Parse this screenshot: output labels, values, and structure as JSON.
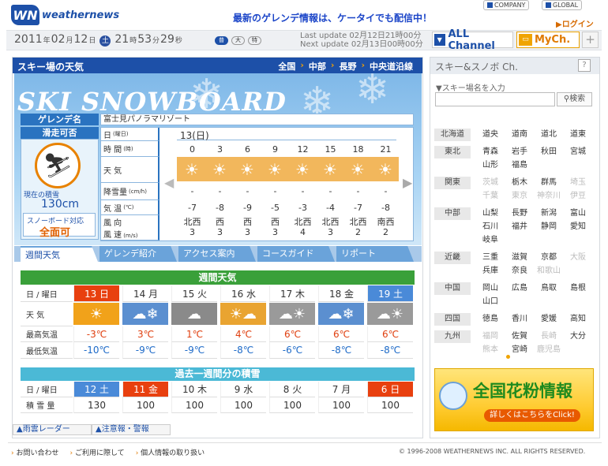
{
  "header": {
    "logo_mark": "WN",
    "logo_text": "weathernews",
    "promo": "最新のゲレンデ情報は、ケータイでも配信中！",
    "company": "COMPANY",
    "global": "GLOBAL",
    "login": "ログイン"
  },
  "topbar": {
    "year": "2011",
    "y_unit": "年",
    "month": "02",
    "m_unit": "月",
    "day": "12",
    "d_unit": "日",
    "dow": "土",
    "hour": "21",
    "h_unit": "時",
    "min": "53",
    "mi_unit": "分",
    "sec": "29",
    "s_unit": "秒",
    "font_sizes": [
      "普",
      "大",
      "特"
    ],
    "last_update": "Last update 02月12日21時00分",
    "next_update": "Next update 02月13日00時00分",
    "all_channel": "ALL Channel",
    "mych": "MyCh.",
    "plus": "+"
  },
  "main": {
    "title": "スキー場の天気",
    "breadcrumb": [
      "全国",
      "中部",
      "長野",
      "中央道沿線"
    ],
    "logo": "SKI SNOWBOARD",
    "ski_label": "ゲレンデ名",
    "ski_name": "富士見パノラマリゾート",
    "open_label": "滑走可否",
    "depth_label": "現在の積雪",
    "depth_value": "130cm",
    "sb_label": "スノーボード対応",
    "sb_value": "全面可",
    "row_labels": {
      "date": "日",
      "date_sub": "(曜日)",
      "time": "時 間",
      "time_sub": "(時)",
      "weather": "天 気",
      "precip": "降雪量",
      "precip_sub": "(cm/h)",
      "temp": "気 温",
      "temp_sub": "(℃)",
      "wind_dir": "風 向",
      "wind_speed": "風 速",
      "wind_sub": "(m/s)"
    },
    "day": "13(日)",
    "hours": [
      "0",
      "3",
      "6",
      "9",
      "12",
      "15",
      "18",
      "21"
    ],
    "precip": [
      "-",
      "-",
      "-",
      "-",
      "-",
      "-",
      "-",
      "-"
    ],
    "temps": [
      "-7",
      "-8",
      "-9",
      "-5",
      "-3",
      "-4",
      "-7",
      "-8"
    ],
    "wind_dirs": [
      "北西",
      "西",
      "西",
      "西",
      "北西",
      "北西",
      "北西",
      "南西"
    ],
    "wind_speeds": [
      "3",
      "3",
      "3",
      "3",
      "4",
      "3",
      "2",
      "2"
    ],
    "tabs": [
      "週間天気",
      "ゲレンデ紹介",
      "アクセス案内",
      "コースガイド",
      "リポート"
    ]
  },
  "weekly": {
    "title": "週間天気",
    "labels": [
      "日 / 曜日",
      "天 気",
      "最高気温",
      "最低気温"
    ],
    "days": [
      {
        "d": "13 日",
        "type": "sun",
        "hi": "-3℃",
        "lo": "-10℃"
      },
      {
        "d": "14 月",
        "type": "cloud-snow",
        "hi": "3℃",
        "lo": "-9℃"
      },
      {
        "d": "15 火",
        "type": "cloud",
        "hi": "1℃",
        "lo": "-9℃"
      },
      {
        "d": "16 水",
        "type": "sun-cloud",
        "hi": "4℃",
        "lo": "-8℃"
      },
      {
        "d": "17 木",
        "type": "cloud-sun",
        "hi": "6℃",
        "lo": "-6℃"
      },
      {
        "d": "18 金",
        "type": "cloud-snow",
        "hi": "6℃",
        "lo": "-8℃"
      },
      {
        "d": "19 土",
        "type": "cloud-sun",
        "hi": "6℃",
        "lo": "-8℃"
      }
    ]
  },
  "past": {
    "title": "過去一週間分の積雪",
    "labels": [
      "日 / 曜日",
      "積 雪 量"
    ],
    "days": [
      "12 土",
      "11 金",
      "10 木",
      "9 水",
      "8 火",
      "7 月",
      "6 日"
    ],
    "values": [
      "130",
      "100",
      "100",
      "100",
      "100",
      "100",
      "100"
    ]
  },
  "links": [
    "雨雲レーダー",
    "注意報・警報"
  ],
  "side": {
    "title": "スキー&スノボ Ch.",
    "help": "?",
    "search_label": "▼スキー場名を入力",
    "search_btn": "検索",
    "regions": [
      {
        "name": "北海道",
        "prefs": [
          "道央",
          "道南",
          "道北",
          "道東"
        ],
        "dim": []
      },
      {
        "name": "東北",
        "prefs": [
          "青森",
          "岩手",
          "秋田",
          "宮城",
          "山形",
          "福島"
        ],
        "dim": []
      },
      {
        "name": "関東",
        "prefs": [
          "茨城",
          "栃木",
          "群馬",
          "埼玉",
          "千葉",
          "東京",
          "神奈川",
          "伊豆"
        ],
        "dim": [
          0,
          3,
          4,
          5,
          6,
          7
        ]
      },
      {
        "name": "中部",
        "prefs": [
          "山梨",
          "長野",
          "新潟",
          "富山",
          "石川",
          "福井",
          "静岡",
          "愛知",
          "岐阜"
        ],
        "dim": []
      },
      {
        "name": "近畿",
        "prefs": [
          "三重",
          "滋賀",
          "京都",
          "大阪",
          "兵庫",
          "奈良",
          "和歌山"
        ],
        "dim": [
          3,
          6
        ]
      },
      {
        "name": "中国",
        "prefs": [
          "岡山",
          "広島",
          "鳥取",
          "島根",
          "山口"
        ],
        "dim": []
      },
      {
        "name": "四国",
        "prefs": [
          "徳島",
          "香川",
          "愛媛",
          "高知"
        ],
        "dim": []
      },
      {
        "name": "九州",
        "prefs": [
          "福岡",
          "佐賀",
          "長崎",
          "大分",
          "熊本",
          "宮崎",
          "鹿児島"
        ],
        "dim": [
          0,
          2,
          4,
          6
        ]
      }
    ],
    "banner_title": "全国花粉情報",
    "banner_cta": "詳しくはこちらをClick!"
  },
  "footer": {
    "links": [
      "お問い合わせ",
      "ご利用に際して",
      "個人情報の取り扱い"
    ],
    "copyright": "© 1996-2008 WEATHERNEWS INC. ALL RIGHTS RESERVED."
  },
  "colors": {
    "brand": "#1d50a8",
    "accent": "#e07a00",
    "weekly_head": "#3aa03a",
    "past_head": "#4bb9d6"
  }
}
